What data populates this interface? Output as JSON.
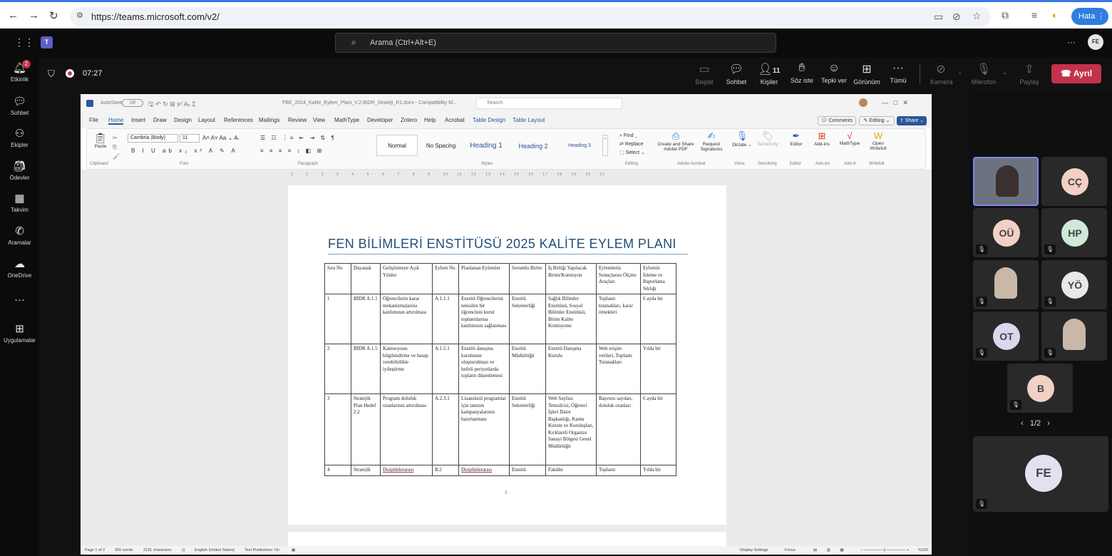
{
  "browser": {
    "url": "https://teams.microsoft.com/v2/",
    "profile_label": "Hata"
  },
  "teams": {
    "search_placeholder": "Arama (Ctrl+Alt+E)",
    "avatar_initials": "FE"
  },
  "rail": [
    {
      "icon": "bell-icon",
      "label": "Etkinlik",
      "badge": "2"
    },
    {
      "icon": "chat-icon",
      "label": "Sohbet"
    },
    {
      "icon": "teams-icon",
      "label": "Ekipler"
    },
    {
      "icon": "assignments-icon",
      "label": "Ödevler"
    },
    {
      "icon": "calendar-icon",
      "label": "Takvim"
    },
    {
      "icon": "calls-icon",
      "label": "Aramalar"
    },
    {
      "icon": "onedrive-icon",
      "label": "OneDrive"
    },
    {
      "icon": "more-icon",
      "label": "..."
    },
    {
      "icon": "apps-icon",
      "label": "Uygulamalar"
    }
  ],
  "meeting": {
    "timer": "07:27",
    "people_count": "11",
    "buttons": [
      "Başlat",
      "Sohbet",
      "Kişiler",
      "Söz iste",
      "Tepki ver",
      "Görünüm",
      "Tümü",
      "Kamera",
      "Mikrofon",
      "Paylaş"
    ],
    "leave": "Ayrıl"
  },
  "word": {
    "filename": "FBE_2024_Kalite_Eylem_Plani_V.2.BIDR_Strateji_R1.docx - Compatibility M...",
    "search": "Search",
    "autosave": "AutoSave",
    "autosave_state": "Off",
    "menu": [
      "File",
      "Home",
      "Insert",
      "Draw",
      "Design",
      "Layout",
      "References",
      "Mailings",
      "Review",
      "View",
      "MathType",
      "Developer",
      "Zotero",
      "Help",
      "Acrobat",
      "Table Design",
      "Table Layout"
    ],
    "comments": "Comments",
    "editing": "Editing",
    "share": "Share",
    "font": "Cambria (Body)",
    "size": "11",
    "styles": [
      "Normal",
      "No Spacing",
      "Heading 1",
      "Heading 2",
      "Heading 3"
    ],
    "groups": [
      "Clipboard",
      "Font",
      "Paragraph",
      "Styles",
      "Editing",
      "Adobe Acrobat",
      "Voice",
      "Sensitivity",
      "Editor",
      "Add-ins",
      "Add-in",
      "Writefull"
    ],
    "paste": "Paste",
    "editing_btns": [
      "Find",
      "Replace",
      "Select"
    ],
    "right_btns": [
      "Create and Share Adobe PDF",
      "Request Signatures",
      "Dictate",
      "Sensitivity",
      "Editor",
      "Add-ins",
      "MathType",
      "Open Writefull"
    ],
    "status": {
      "page": "Page 1 of 2",
      "words": "266 words",
      "chars": "2131 characters",
      "lang": "English (United States)",
      "pred": "Text Predictions: On",
      "display": "Display Settings",
      "focus": "Focus",
      "zoom": "%100"
    },
    "page_number": "1"
  },
  "document": {
    "title": "FEN BİLİMLERİ ENSTİTÜSÜ 2025 KALİTE EYLEM PLANI",
    "headers": [
      "Sıra No",
      "Dayanak",
      "Geliştirmeye Açık Yönler",
      "Eylem No",
      "Planlanan Eylemler",
      "Sorumlu Birim",
      "İş Birliği Yapılacak Birim/Komisyon",
      "Eylemlerin Sonuçlarını Ölçme Araçları",
      "Eylemin İzleme ve Raporlama Sıklığı"
    ],
    "rows": [
      [
        "1",
        "BİDR A.1.1",
        "Öğrencilerin karar mekanizmalarına katılımının artırılması",
        "A.1.1.1",
        "Enstitü Öğrencilerini temsilen bir öğrencinin kurul toplantılarına katılımının sağlanması",
        "Enstitü Sekreterliği",
        "Sağlık Bilimler Enstitüsü, Sosyal Bilimler Enstitüsü, Birim Kalite Komisyonu",
        "Toplantı tutanakları, karar örnekleri",
        "6 ayda bir"
      ],
      [
        "2",
        "BİDR A.1.5",
        "Kamuoyunu bilgilendirme ve hesap verebilirlikte iyileştirme",
        "A.1.5.1",
        "Enstitü danışma kurulunun oluşturulması ve belirli periyotlarda toplantı düzenlemesi",
        "Enstitü Müdürlüğü",
        "Enstitü Danışma Kurulu",
        "Web erişim verileri, Toplantı Tutanakları",
        "Yılda bir"
      ],
      [
        "3",
        "Stratejik Plan Hedef 2.2",
        "Program doluluk oranlarının artırılması",
        "A.2.3.1",
        "Lisansüstü programlar için tanıtım kampanyalarının hazırlanması",
        "Enstitü Sekreterliği",
        "Web Sayfası Temsilcisi, Öğrenci İşleri Daire Başkanlığı, Kamu Kurum ve Kuruluşları, Kırklareli Organize Sanayi Bölgesi Genel Müdürlüğü",
        "Başvuru sayıları, doluluk oranları",
        "6 ayda bir"
      ],
      [
        "4",
        "Stratejik",
        "Disiplinlerarası",
        "B.2",
        "Disiplinlerarası",
        "Enstitü",
        "Fakülte",
        "Toplantı",
        "Yılda bir"
      ]
    ]
  },
  "participants": {
    "tiles": [
      {
        "initials": "",
        "video": true
      },
      {
        "initials": "CÇ",
        "color": "#f2d0c6",
        "muted": false
      },
      {
        "initials": "OÜ",
        "color": "#f2d0c6",
        "muted": true
      },
      {
        "initials": "HP",
        "color": "#cfe8d8",
        "muted": true
      },
      {
        "initials": "",
        "video": true,
        "muted": true
      },
      {
        "initials": "YÖ",
        "color": "#e8e8e8",
        "muted": true
      },
      {
        "initials": "OT",
        "color": "#dcd6ee",
        "muted": true
      },
      {
        "initials": "",
        "video": true,
        "muted": true
      },
      {
        "initials": "B",
        "color": "#f2d0c6",
        "muted": true
      }
    ],
    "pager": "1/2",
    "self_initials": "FE"
  }
}
